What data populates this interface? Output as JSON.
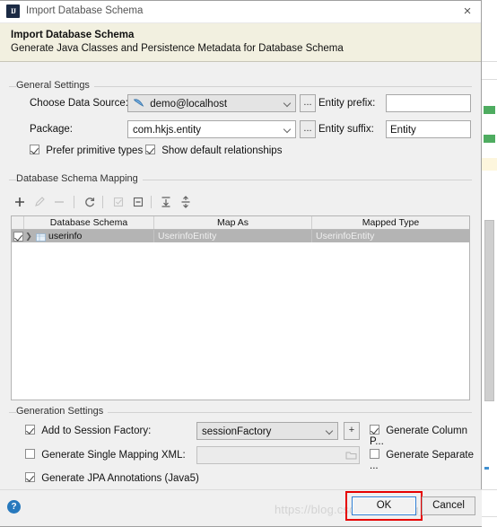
{
  "window": {
    "title": "Import Database Schema",
    "app_icon": "intellij-idea-icon",
    "close_label": "×"
  },
  "banner": {
    "title": "Import Database Schema",
    "subtitle": "Generate Java Classes and Persistence Metadata for Database Schema"
  },
  "general_settings": {
    "legend": "General Settings",
    "data_source_label": "Choose Data Source:",
    "data_source_value": "demo@localhost",
    "data_source_browse": "...",
    "package_label": "Package:",
    "package_value": "com.hkjs.entity",
    "package_browse": "...",
    "entity_prefix_label": "Entity prefix:",
    "entity_prefix_value": "",
    "entity_suffix_label": "Entity suffix:",
    "entity_suffix_value": "Entity",
    "prefer_primitive_types": {
      "label": "Prefer primitive types",
      "checked": true
    },
    "show_default_relationships": {
      "label": "Show default relationships",
      "checked": true
    }
  },
  "schema_mapping": {
    "legend": "Database Schema Mapping",
    "toolbar": [
      {
        "name": "add-icon",
        "glyph": "+",
        "enabled": true
      },
      {
        "name": "edit-pencil-icon",
        "glyph": "✎",
        "enabled": false
      },
      {
        "name": "remove-icon",
        "glyph": "−",
        "enabled": false
      },
      {
        "name": "refresh-icon",
        "glyph": "⟳",
        "enabled": true
      },
      {
        "name": "select-all-checkbox-icon",
        "glyph": "☑",
        "enabled": false
      },
      {
        "name": "deselect-all-icon",
        "glyph": "⊟",
        "enabled": true
      },
      {
        "name": "expand-all-icon",
        "glyph": "⤓",
        "enabled": true
      },
      {
        "name": "collapse-all-icon",
        "glyph": "⤒",
        "enabled": true
      }
    ],
    "columns": [
      "Database Schema",
      "Map As",
      "Mapped Type"
    ],
    "rows": [
      {
        "checked": true,
        "expanded": false,
        "schema": "userinfo",
        "map_as": "UserinfoEntity",
        "mapped_type": "UserinfoEntity",
        "selected": true
      }
    ]
  },
  "generation_settings": {
    "legend": "Generation Settings",
    "add_to_session_factory": {
      "label": "Add to Session Factory:",
      "checked": true
    },
    "session_factory_value": "sessionFactory",
    "session_factory_add": "+",
    "generate_single_mapping_xml": {
      "label": "Generate Single Mapping XML:",
      "checked": false
    },
    "single_mapping_xml_value": "",
    "generate_jpa_annotations": {
      "label": "Generate JPA Annotations (Java5)",
      "checked": true
    },
    "generate_column_properties": {
      "label": "Generate Column P...",
      "checked": true
    },
    "generate_separate": {
      "label": "Generate Separate ...",
      "checked": false
    }
  },
  "buttons": {
    "help": "?",
    "ok": "OK",
    "cancel": "Cancel"
  },
  "watermark": "https://blog.csdn.net/zhang_adrian",
  "colors": {
    "banner_bg": "#f2f0e0",
    "dialog_bg": "#f0f0f0",
    "selection": "#b4b4b4",
    "focus_border": "#2f7dd1",
    "highlight_rect": "#e60000",
    "help_blue": "#2779bd"
  }
}
